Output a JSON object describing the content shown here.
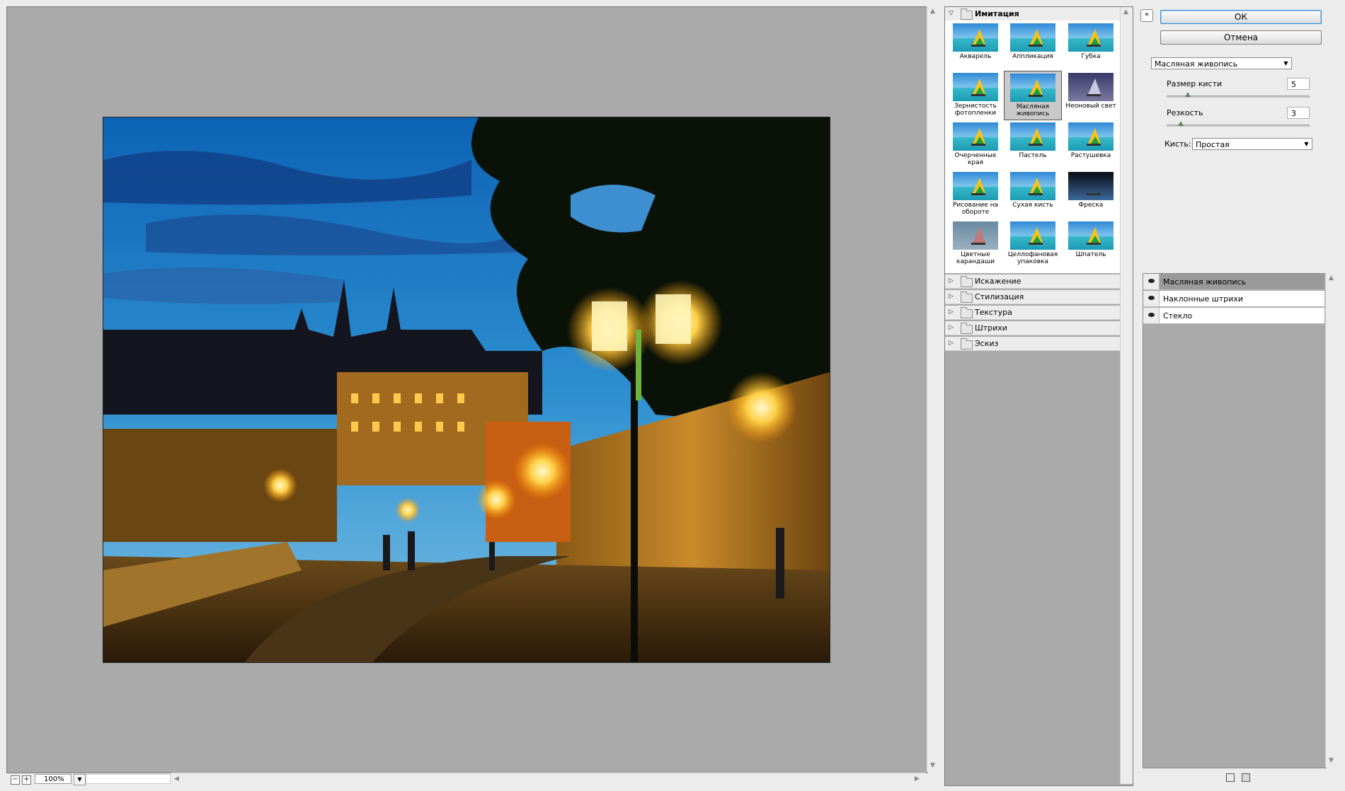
{
  "preview": {
    "zoom_value": "100%",
    "zoom_out_symbol": "−",
    "zoom_in_symbol": "+"
  },
  "buttons": {
    "ok_label": "ОК",
    "cancel_label": "Отмена",
    "collapse_symbol": "«"
  },
  "gallery": {
    "open_category": "Имитация",
    "filters": [
      {
        "name": "Акварель"
      },
      {
        "name": "Аппликация"
      },
      {
        "name": "Губка"
      },
      {
        "name": "Зернистость фотопленки"
      },
      {
        "name": "Масляная живопись",
        "selected": true
      },
      {
        "name": "Неоновый свет"
      },
      {
        "name": "Очерченные края"
      },
      {
        "name": "Пастель"
      },
      {
        "name": "Растушевка"
      },
      {
        "name": "Рисование на обороте"
      },
      {
        "name": "Сухая кисть"
      },
      {
        "name": "Фреска"
      },
      {
        "name": "Цветные карандаши"
      },
      {
        "name": "Целлофановая упаковка"
      },
      {
        "name": "Шпатель"
      }
    ],
    "collapsed_categories": [
      "Искажение",
      "Стилизация",
      "Текстура",
      "Штрихи",
      "Эскиз"
    ]
  },
  "settings": {
    "filter_select": "Масляная живопись",
    "brush_size_label": "Размер кисти",
    "brush_size_value": "5",
    "brush_size_fraction": 0.15,
    "sharpness_label": "Резкость",
    "sharpness_value": "3",
    "sharpness_fraction": 0.1,
    "brush_label": "Кисть:",
    "brush_value": "Простая"
  },
  "layers": {
    "items": [
      {
        "name": "Масляная живопись",
        "active": true
      },
      {
        "name": "Наклонные штрихи",
        "active": false
      },
      {
        "name": "Стекло",
        "active": false
      }
    ]
  },
  "colors": {
    "preview_bg": "#aaaaaa",
    "panel_bg": "#ececec",
    "ok_focus": "#3b8ed3"
  }
}
